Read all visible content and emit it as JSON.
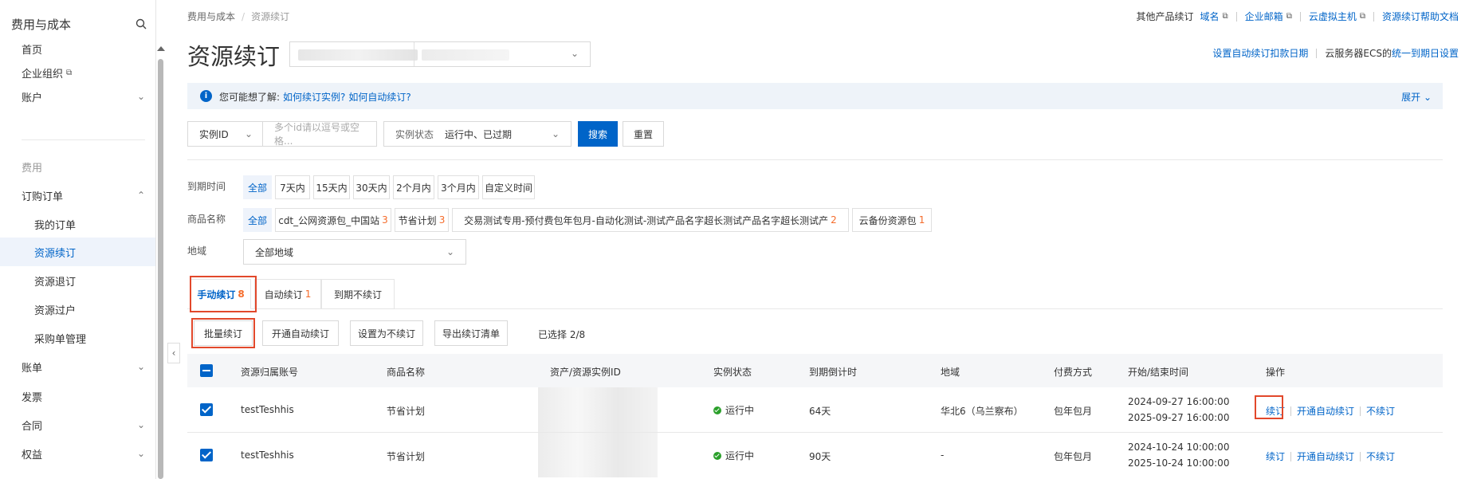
{
  "sidebar": {
    "title": "费用与成本",
    "items": {
      "home": "首页",
      "org": "企业组织",
      "account": "账户",
      "fees_group": "费用",
      "orders": "订购订单",
      "my_orders": "我的订单",
      "renew": "资源续订",
      "refund": "资源退订",
      "expire": "资源过户",
      "purchase": "采购单管理",
      "bills": "账单",
      "invoice": "发票",
      "contract": "合同",
      "rights": "权益"
    }
  },
  "breadcrumb": {
    "root": "费用与成本",
    "current": "资源续订"
  },
  "toplinks": {
    "label": "其他产品续订",
    "domain": "域名",
    "mail": "企业邮箱",
    "vhost": "云虚拟主机",
    "help": "资源续订帮助文档"
  },
  "page_title": "资源续订",
  "right_links": {
    "set_date": "设置自动续订扣款日期",
    "ecs_text": "云服务器ECS的",
    "unify": "统一到期日设置"
  },
  "notice": {
    "prefix": "您可能想了解:",
    "link1": "如何续订实例?",
    "link2": "如何自动续订?",
    "expand": "展开"
  },
  "search": {
    "field_label": "实例ID",
    "placeholder": "多个id请以逗号或空格...",
    "status_label": "实例状态",
    "status_value": "运行中、已过期",
    "search_btn": "搜索",
    "reset_btn": "重置"
  },
  "filters": {
    "expire_label": "到期时间",
    "expire_opts": [
      "全部",
      "7天内",
      "15天内",
      "30天内",
      "2个月内",
      "3个月内",
      "自定义时间"
    ],
    "product_label": "商品名称",
    "product_all": "全部",
    "products": [
      {
        "name": "cdt_公网资源包_中国站",
        "count": "3"
      },
      {
        "name": "节省计划",
        "count": "3"
      },
      {
        "name": "交易测试专用-预付费包年包月-自动化测试-测试产品名字超长测试产品名字超长测试产",
        "count": "2"
      },
      {
        "name": "云备份资源包",
        "count": "1"
      }
    ],
    "region_label": "地域",
    "region_value": "全部地域"
  },
  "tabs": [
    {
      "label": "手动续订",
      "count": "8"
    },
    {
      "label": "自动续订",
      "count": "1"
    },
    {
      "label": "到期不续订",
      "count": ""
    }
  ],
  "actions": {
    "batch": "批量续订",
    "enable_auto": "开通自动续订",
    "set_no": "设置为不续订",
    "export": "导出续订清单",
    "selected": "已选择 2/8"
  },
  "table": {
    "headers": [
      "资源归属账号",
      "商品名称",
      "资产/资源实例ID",
      "实例状态",
      "到期倒计时",
      "地域",
      "付费方式",
      "开始/结束时间",
      "操作"
    ],
    "rows": [
      {
        "account": "testTeshhis",
        "product": "节省计划",
        "status": "运行中",
        "countdown": "64天",
        "region": "华北6（乌兰察布）",
        "pay": "包年包月",
        "start": "2024-09-27 16:00:00",
        "end": "2025-09-27 16:00:00",
        "op_renew": "续订",
        "op_auto": "开通自动续订",
        "op_no": "不续订"
      },
      {
        "account": "testTeshhis",
        "product": "节省计划",
        "status": "运行中",
        "countdown": "90天",
        "region": "-",
        "pay": "包年包月",
        "start": "2024-10-24 10:00:00",
        "end": "2025-10-24 10:00:00",
        "op_renew": "续订",
        "op_auto": "开通自动续订",
        "op_no": "不续订"
      }
    ]
  },
  "colors": {
    "accent": "#0064c8",
    "highlight": "#e2482b",
    "count": "#f56c2b",
    "running": "#2ba02b"
  }
}
